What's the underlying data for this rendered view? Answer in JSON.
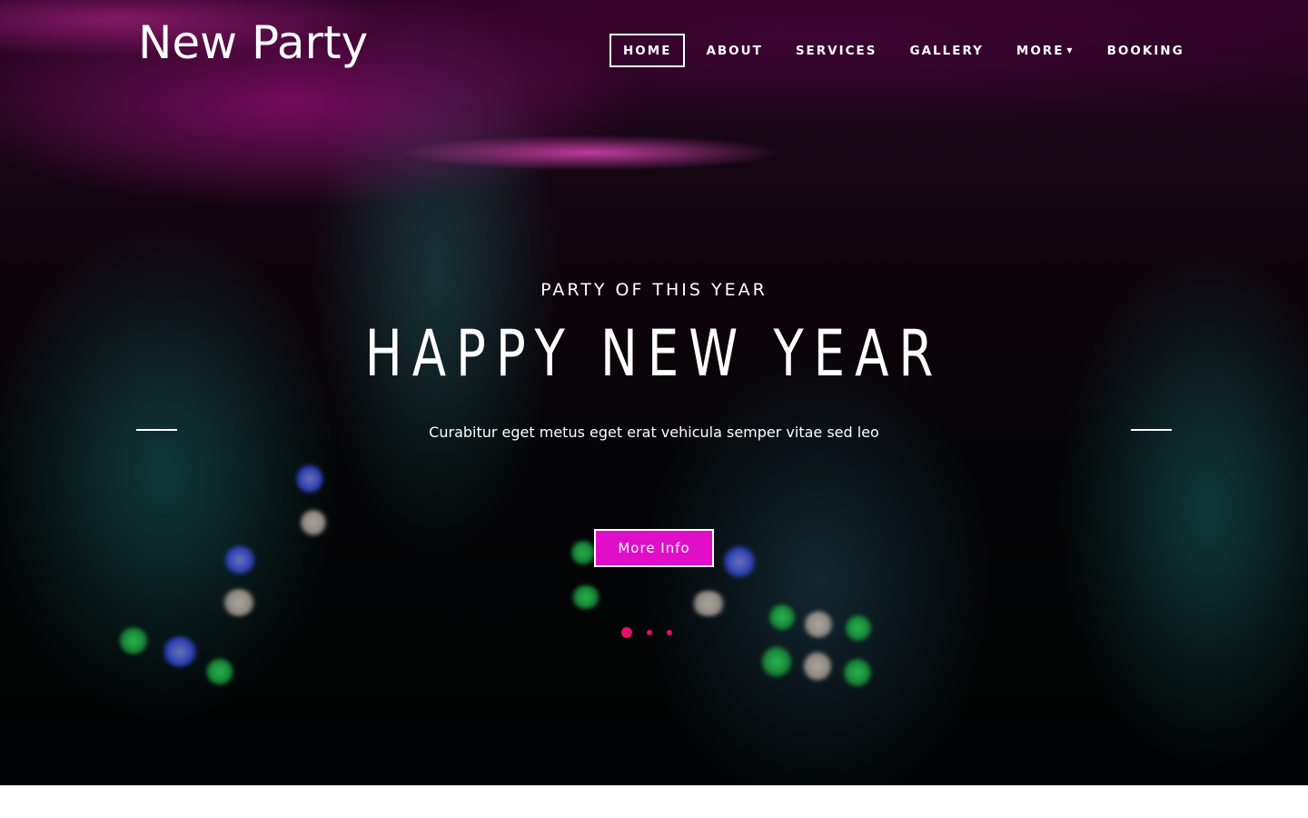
{
  "brand": {
    "logo_text": "New Party"
  },
  "nav": {
    "items": [
      {
        "label": "Home",
        "active": true
      },
      {
        "label": "About",
        "active": false
      },
      {
        "label": "Services",
        "active": false
      },
      {
        "label": "Gallery",
        "active": false
      },
      {
        "label": "More",
        "active": false,
        "has_dropdown": true
      },
      {
        "label": "Booking",
        "active": false
      }
    ]
  },
  "hero": {
    "kicker": "PARTY OF THIS YEAR",
    "headline": "HAPPY NEW YEAR",
    "subtext": "Curabitur eget metus eget erat vehicula semper vitae sed leo",
    "cta_label": "More Info",
    "slide_count": 3,
    "active_slide": 1
  },
  "colors": {
    "accent": "#e10ec9",
    "dot": "#e10e6a",
    "text": "#ffffff"
  }
}
